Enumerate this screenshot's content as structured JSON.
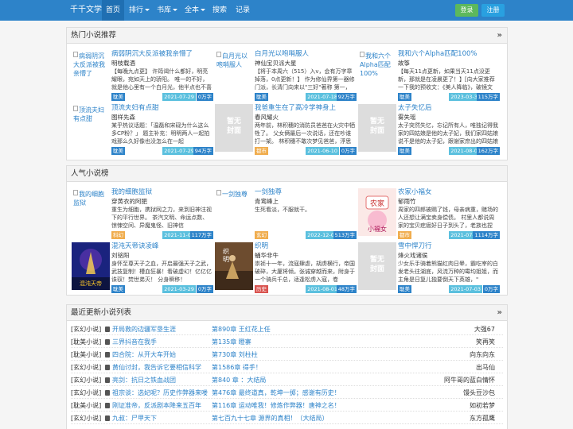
{
  "nav": {
    "brand": "千千文学",
    "items": [
      "首页",
      "排行",
      "书库",
      "全本",
      "搜索",
      "记录"
    ],
    "login": "登录",
    "register": "注册"
  },
  "hot": {
    "title": "热门小说推荐",
    "books": [
      {
        "cover_alt": "病弱阴沉大反派被我亲懵了",
        "title": "病弱阴沉大反派被我亲懵了",
        "author": "明枝载酒",
        "desc": "【每晚九点更】 许筠谒什么都好，明亮耀眼，宛如天上的骄阳。 唯一的不好，就是他心里有一个白月光，他半点也不喜",
        "tag": "耽美",
        "date": "2021-07-29",
        "count": "0万字"
      },
      {
        "cover_alt": "白月光以咆哨服人",
        "title": "白月光以咆哨服人",
        "author": "神仙宝贝派大星",
        "desc": "【将于本周六（515）入v，会有万字章掉落，0点更新！】 作为修仙界第一器修门派，长清门向来以\"三好\"著称 第一，",
        "tag": "耽美",
        "date": "2021-07-18",
        "count": "92万字"
      },
      {
        "cover_alt": "我和六个Alpha匹配100%",
        "title": "我和六个Alpha匹配100%",
        "author": "故筝",
        "desc": "【每天11点更新，如果当天11点没更新，那就是在凌晨更了！】[向大家推荐一下我的预收文：《美人降临》，破镜文案：请",
        "tag": "耽美",
        "date": "2023-03-31",
        "count": "115万字"
      },
      {
        "cover_alt": "顶流夫妇有点甜",
        "title": "顶流夫妇有点甜",
        "author": "图样先森",
        "desc": "某乎热议话题：「温磊和宋砚为什么这么多CP粉？」 题主补充：明明两人一起拍戏那么久好像也没怎么在一起",
        "tag": "耽美",
        "date": "2021-07-29",
        "count": "94万字"
      },
      {
        "cover_alt": "",
        "title": "我爸重生在了高冷学神身上",
        "author": "春风耀火",
        "desc": "两年前，林积穗的消防员爸爸在火灾中牺牲了。 父女俩最后一次说话，还在吵谁打一架。 林积穗不敢次梦见爸爸，浮思",
        "tag": "都市",
        "date": "2021-06-10",
        "count": "0万字"
      },
      {
        "cover_alt": "",
        "title": "太子失忆后",
        "author": "雾失瑶",
        "desc": "太子突然失忆，忘记所有人，唯独记得我家的四姑娘是他的太子妃，我们家四姑娘说不是他的太子妃，跟谢家庶出的四姑娘",
        "tag": "耽美",
        "date": "2021-08-02",
        "count": "162万字"
      }
    ]
  },
  "popular": {
    "title": "人气小说榜",
    "books": [
      {
        "cover_alt": "我的细胞监狱",
        "title": "我的细胞监狱",
        "author": "穿黄衣的阿肥",
        "desc": "重生为细胞，携狱网之力，来到旧神注视下的平行世界。 茶汽文明、命运点数、惊悚空间、异魔鬼怪、旧神信",
        "tag": "科幻",
        "date": "2021-11-05",
        "count": "117万字"
      },
      {
        "cover_alt": "一剑独尊",
        "title": "一剑独尊",
        "author": "青鸾峰上",
        "desc": "生死看淡，不服就干。",
        "tag": "玄幻",
        "date": "2022-12-03",
        "count": "513万字"
      },
      {
        "cover_alt": "农家小福女",
        "title": "农家小福女",
        "author": "郁雨竹",
        "desc": "周家的四郎被赐了钱，母亲病重，赌场的人还想让满宝卖身偿债。 村里人都说周家的宝贝疙瘩好日子到头了，老族也捏",
        "tag": "都市",
        "date": "2021-07-22",
        "count": "1114万字"
      },
      {
        "cover_alt": "混沌天帝诀凌峰",
        "title": "混沌天帝诀凌峰",
        "author": "刘铭阳",
        "desc": "身怀至尊天子之血，开启最强天子之武，武技复制！槽血狂暴！看破虚幻！亿亿亿诛驭！焚世弟灭！ 分身瞬移！",
        "tag": "耽美",
        "date": "2021-03-29",
        "count": "0万字"
      },
      {
        "cover_alt": "织明",
        "title": "织明",
        "author": "蛹华非牛",
        "desc": "崇祯十一年，流寇肆虐，胡虏横行，帝国破碎，大厦将倾。张诚穿越而来，附身于一个骑兵千总，适逢松虏入寇，卷",
        "tag": "历史",
        "date": "2021-08-01",
        "count": "48万字"
      },
      {
        "cover_alt": "",
        "title": "雪中悍刀行",
        "author": "烽火戏诸侯",
        "desc": "少女乐手骑着熊猫红肉日晕，霸吃宰的白发老头往湖底，风流万种的霉均姐姐，而主角是日复儿独要倒天下英雄，\"",
        "tag": "耽美",
        "date": "2021-07-03",
        "count": "0万字"
      }
    ]
  },
  "latest": {
    "title": "最近更新小说列表",
    "rows": [
      {
        "cat": "[玄幻小说]",
        "book": "开局救的边疆军垦生涯",
        "chapter": "第890章 王红花上任",
        "author": "大强67"
      },
      {
        "cat": "[耽美小说]",
        "book": "三界抖音在我手",
        "chapter": "第135章 瞪寨",
        "author": "笑再笑"
      },
      {
        "cat": "[耽美小说]",
        "book": "四合院：从开大车开始",
        "chapter": "第730章 刘柱柱",
        "author": "向东向东"
      },
      {
        "cat": "[玄幻小说]",
        "book": "黄仙讨封，我告诉它要相信科学",
        "chapter": "第1586章 得手！",
        "author": "出马仙"
      },
      {
        "cat": "[玄幻小说]",
        "book": "亮剑：抗日之铁血战团",
        "chapter": "第840 章 ：大结局",
        "author": "阿牛哥的蓝白情怀"
      },
      {
        "cat": "[玄幻小说]",
        "book": "祖宗谈：选妃呢？历史作弊器来喽",
        "chapter": "第476章 最终道真，乾坤一掷；感谢有历史！",
        "author": "馒头豆沙包"
      },
      {
        "cat": "[耽美小说]",
        "book": "刚证准帝，反派剧本降来五百年",
        "chapter": "第116章 运动唯我！修炼作弊器！唐神之名！",
        "author": "如初若梦"
      },
      {
        "cat": "[玄幻小说]",
        "book": "九叔：尸甲天下",
        "chapter": "第七百九十七章 源界的真相！（大结局）",
        "author": "东方孤鹰"
      }
    ]
  }
}
